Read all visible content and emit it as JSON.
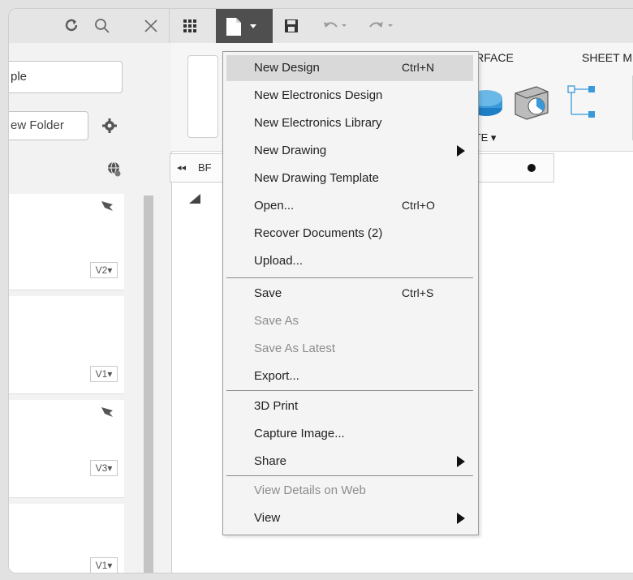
{
  "toolbar": {
    "refresh": "refresh-icon",
    "search": "search-icon",
    "close": "close-icon",
    "grid": "grid-icon",
    "file": "file-icon",
    "save": "save-icon",
    "undo": "undo-icon",
    "redo": "redo-icon"
  },
  "left": {
    "search_value": "ple",
    "new_folder_label": "ew Folder",
    "versions": [
      "V2▾",
      "V1▾",
      "V3▾",
      "V1▾"
    ]
  },
  "ribbon": {
    "tab_surface": "URFACE",
    "tab_sheet": "SHEET M",
    "create_label": "ATE ▾"
  },
  "browser": {
    "label": "BF"
  },
  "menu": {
    "items": [
      {
        "label": "New Design",
        "shortcut": "Ctrl+N"
      },
      {
        "label": "New Electronics Design",
        "shortcut": ""
      },
      {
        "label": "New Electronics Library",
        "shortcut": ""
      },
      {
        "label": "New Drawing",
        "shortcut": ""
      },
      {
        "label": "New Drawing Template",
        "shortcut": ""
      },
      {
        "label": "Open...",
        "shortcut": "Ctrl+O"
      },
      {
        "label": "Recover Documents (2)",
        "shortcut": ""
      },
      {
        "label": "Upload...",
        "shortcut": ""
      },
      {
        "label": "Save",
        "shortcut": "Ctrl+S"
      },
      {
        "label": "Save As",
        "shortcut": ""
      },
      {
        "label": "Save As Latest",
        "shortcut": ""
      },
      {
        "label": "Export...",
        "shortcut": ""
      },
      {
        "label": "3D Print",
        "shortcut": ""
      },
      {
        "label": "Capture Image...",
        "shortcut": ""
      },
      {
        "label": "Share",
        "shortcut": ""
      },
      {
        "label": "View Details on Web",
        "shortcut": ""
      },
      {
        "label": "View",
        "shortcut": ""
      }
    ]
  },
  "colors": {
    "accent_blue": "#3a9ad9",
    "toolbar_bg": "#e5e5e5",
    "menu_bg": "#f4f4f4"
  }
}
